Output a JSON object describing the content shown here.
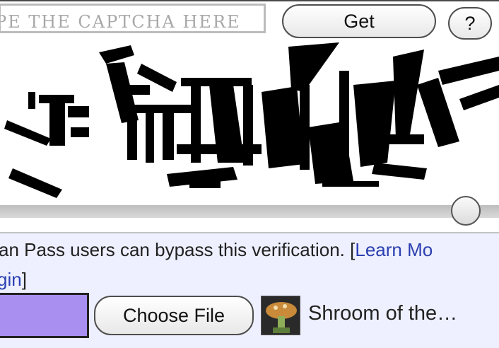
{
  "captcha": {
    "input_placeholder": "PE THE CAPTCHA HERE",
    "get_label": "Get",
    "help_label": "?",
    "image_desc": "captcha-image"
  },
  "pass_notice": {
    "text": "an Pass users can bypass this verification. ",
    "bracket_open": "[",
    "learn_more": "Learn Mo",
    "login_link": "gin",
    "bracket_close": "]"
  },
  "file": {
    "choose_label": "Choose File",
    "filename": "Shroom of the…"
  },
  "colors": {
    "link": "#2b3fb0",
    "form_bg": "#eef0ff",
    "submit_bg": "#a98ff0"
  },
  "icons": [
    "help-icon",
    "mushroom-thumbnail"
  ]
}
